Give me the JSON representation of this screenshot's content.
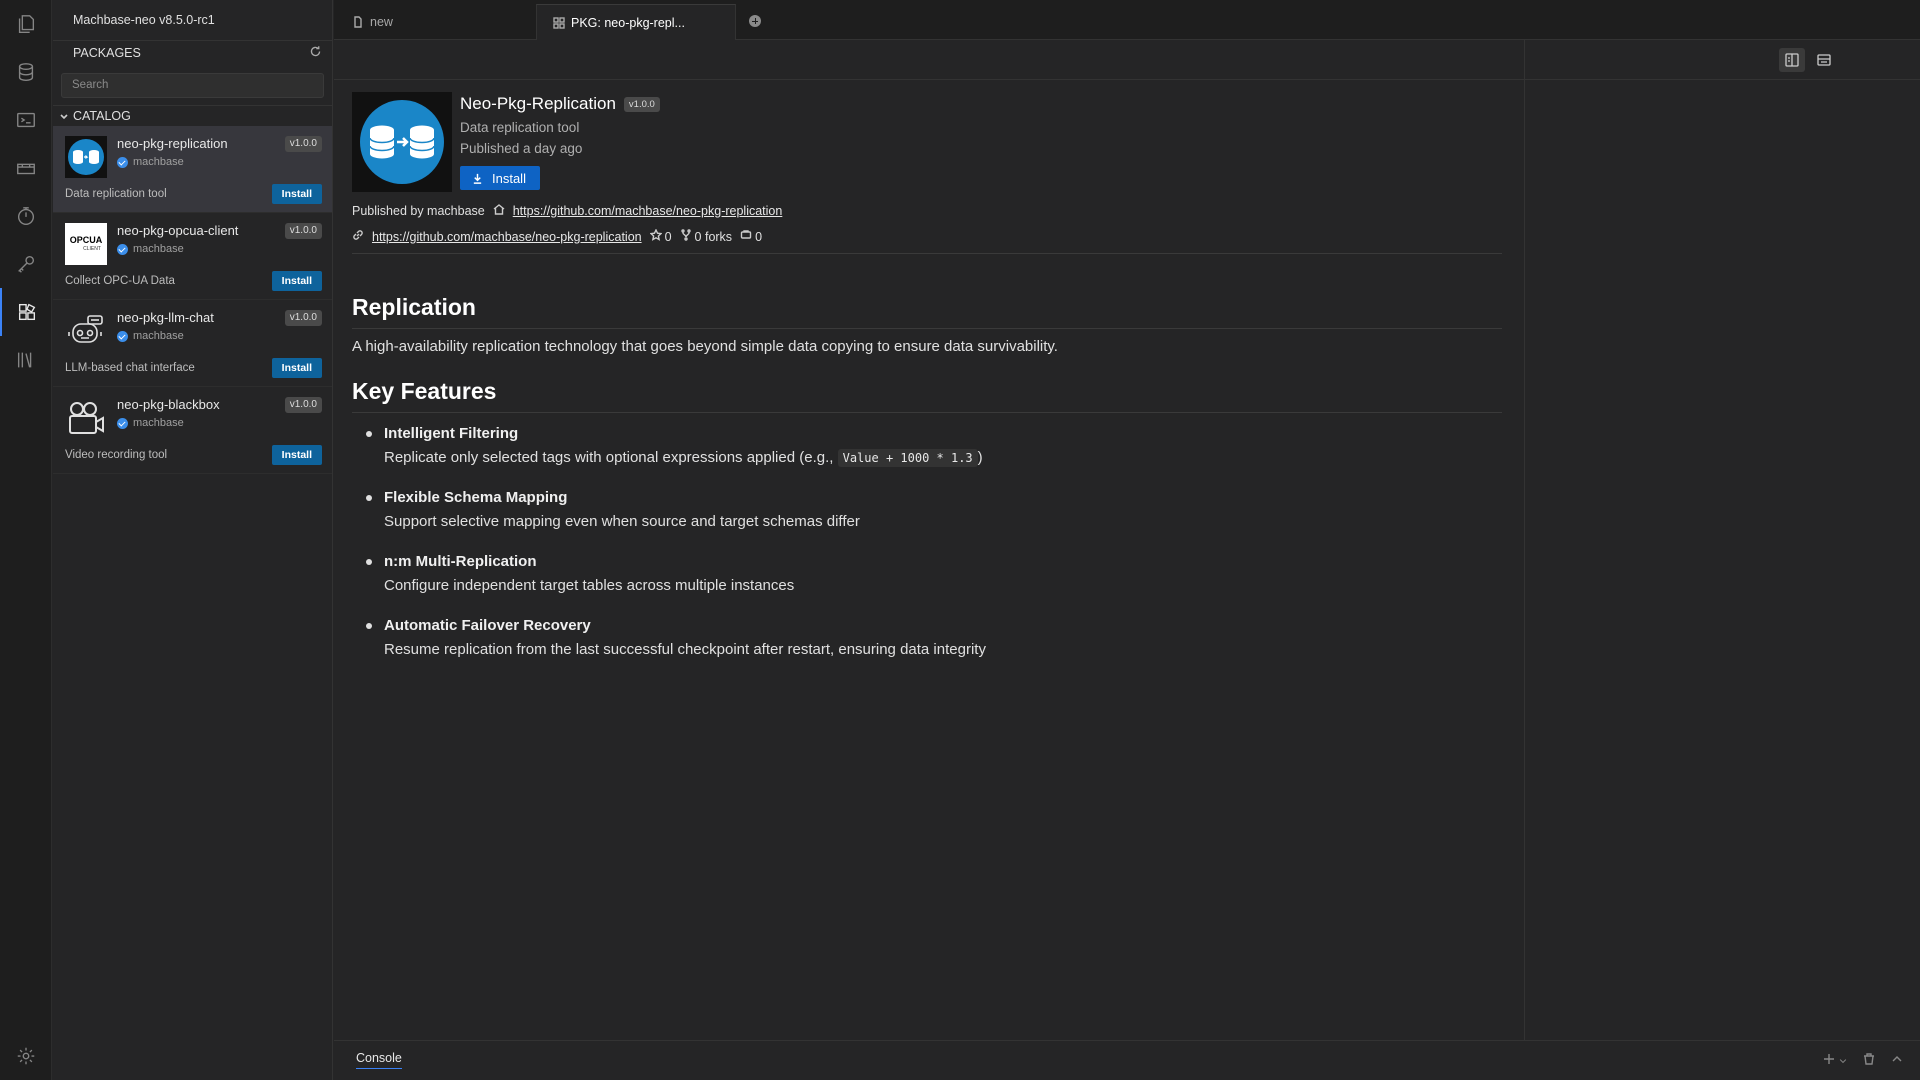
{
  "app": {
    "title": "Machbase-neo v8.5.0-rc1"
  },
  "sidebar": {
    "header": "PACKAGES",
    "search_placeholder": "Search",
    "section": "CATALOG",
    "items": [
      {
        "name": "neo-pkg-replication",
        "publisher": "machbase",
        "version": "v1.0.0",
        "description": "Data replication tool",
        "install_label": "Install"
      },
      {
        "name": "neo-pkg-opcua-client",
        "publisher": "machbase",
        "version": "v1.0.0",
        "description": "Collect OPC-UA Data",
        "install_label": "Install",
        "logo_text": "OPCUA",
        "logo_sub": "CLIENT"
      },
      {
        "name": "neo-pkg-llm-chat",
        "publisher": "machbase",
        "version": "v1.0.0",
        "description": "LLM-based chat interface",
        "install_label": "Install"
      },
      {
        "name": "neo-pkg-blackbox",
        "publisher": "machbase",
        "version": "v1.0.0",
        "description": "Video recording tool",
        "install_label": "Install"
      }
    ]
  },
  "tabs": [
    {
      "label": "new"
    },
    {
      "label": "PKG: neo-pkg-repl..."
    }
  ],
  "detail": {
    "title": "Neo-Pkg-Replication",
    "version": "v1.0.0",
    "description": "Data replication tool",
    "published": "Published a day ago",
    "install_label": "Install",
    "published_by": "Published by machbase",
    "homepage": "https://github.com/machbase/neo-pkg-replication",
    "repo": "https://github.com/machbase/neo-pkg-replication",
    "stars": "0",
    "forks": "0 forks",
    "issues": "0"
  },
  "readme": {
    "h1": "Replication",
    "intro": "A high-availability replication technology that goes beyond simple data copying to ensure data survivability.",
    "h2": "Key Features",
    "features": [
      {
        "title": "Intelligent Filtering",
        "text": "Replicate only selected tags with optional expressions applied (e.g., ",
        "code": "Value + 1000 * 1.3",
        "suffix": ")"
      },
      {
        "title": "Flexible Schema Mapping",
        "text": "Support selective mapping even when source and target schemas differ"
      },
      {
        "title": "n:m Multi-Replication",
        "text": "Configure independent target tables across multiple instances"
      },
      {
        "title": "Automatic Failover Recovery",
        "text": "Resume replication from the last successful checkpoint after restart, ensuring data integrity"
      }
    ]
  },
  "console": {
    "tab": "Console"
  },
  "colors": {
    "accent": "#0e639c",
    "install_blue": "#0e63c4",
    "verified": "#3b8eea",
    "logo_bg": "#1a86c8"
  }
}
